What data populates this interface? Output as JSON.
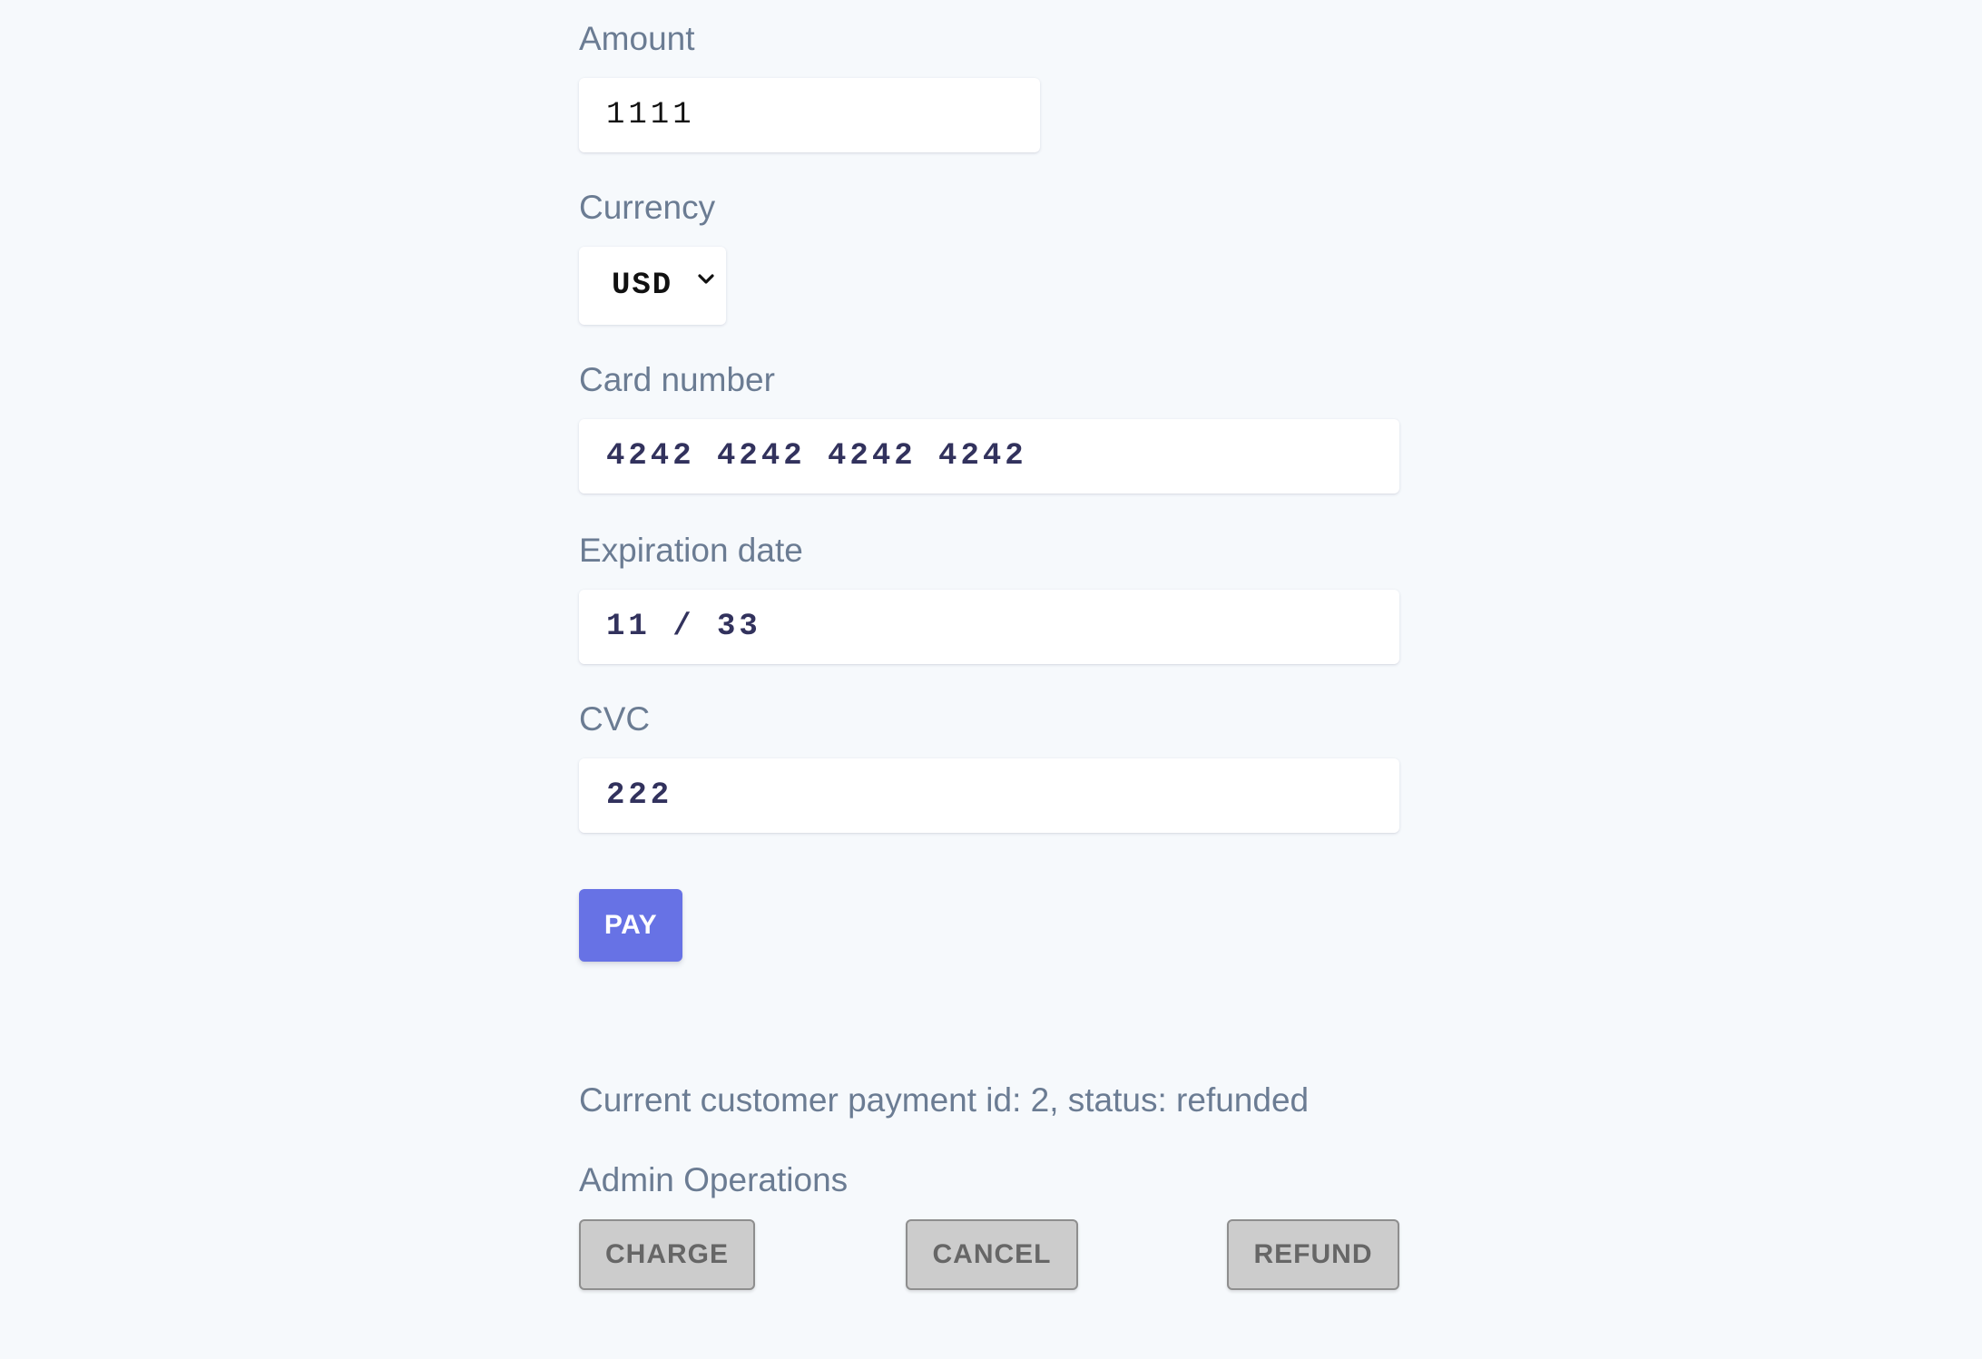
{
  "amount": {
    "label": "Amount",
    "value": "1111"
  },
  "currency": {
    "label": "Currency",
    "selected": "USD"
  },
  "card_number": {
    "label": "Card number",
    "value": "4242 4242 4242 4242"
  },
  "expiration": {
    "label": "Expiration date",
    "value": "11 / 33"
  },
  "cvc": {
    "label": "CVC",
    "value": "222"
  },
  "pay_button": {
    "label": "PAY"
  },
  "status": {
    "text": "Current customer payment id: 2, status: refunded"
  },
  "admin": {
    "title": "Admin Operations",
    "charge_label": "CHARGE",
    "cancel_label": "CANCEL",
    "refund_label": "REFUND"
  },
  "colors": {
    "background": "#f6f9fc",
    "accent": "#6772e5",
    "label": "#6b7c93",
    "card_text": "#32325d",
    "admin_button": "#cccccc"
  },
  "icons": {
    "select_arrow": "chevron-down-icon"
  }
}
